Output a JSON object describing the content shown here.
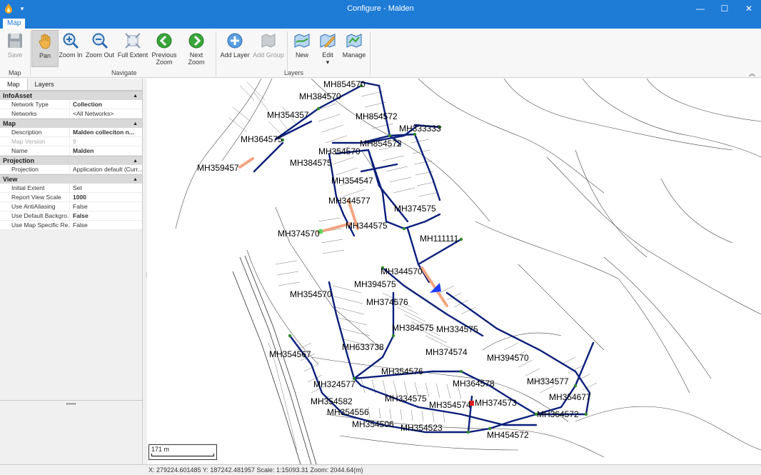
{
  "window": {
    "title": "Configure - Malden",
    "minimize": "—",
    "maximize": "☐",
    "close": "✕",
    "quick_access": "▾"
  },
  "ribbon": {
    "tab": "Map",
    "buttons": {
      "save": "Save",
      "pan": "Pan",
      "zoom_in": "Zoom In",
      "zoom_out": "Zoom Out",
      "full_extent": "Full Extent",
      "previous_zoom": "Previous Zoom",
      "next_zoom": "Next Zoom",
      "add_layer": "Add Layer",
      "add_group": "Add Group",
      "new": "New",
      "edit": "Edit",
      "manage": "Manage"
    },
    "groups": {
      "map": "Map",
      "navigate": "Navigate",
      "layers": "Layers"
    },
    "edit_caret": "▾",
    "collapse": "︽"
  },
  "panel": {
    "tabs": [
      "Map",
      "Layers"
    ],
    "grip": "•••••",
    "splitter_grip": "⋮",
    "categories": [
      {
        "name": "InfoAsset",
        "caret": "▲",
        "rows": [
          {
            "key": "Network Type",
            "value": "Collection",
            "bold": true,
            "dim": false
          },
          {
            "key": "Networks",
            "value": "<All Networks>",
            "bold": false,
            "dim": false
          }
        ]
      },
      {
        "name": "Map",
        "caret": "▲",
        "rows": [
          {
            "key": "Description",
            "value": "Malden colleciton n...",
            "bold": true,
            "dim": false
          },
          {
            "key": "Map Version",
            "value": "9",
            "bold": false,
            "dim": true
          },
          {
            "key": "Name",
            "value": "Malden",
            "bold": true,
            "dim": false
          }
        ]
      },
      {
        "name": "Projection",
        "caret": "▲",
        "rows": [
          {
            "key": "Projection",
            "value": "Application default (Curr...",
            "bold": false,
            "dim": false
          }
        ]
      },
      {
        "name": "View",
        "caret": "▲",
        "rows": [
          {
            "key": "Initial Extent",
            "value": "Set",
            "bold": false,
            "dim": false
          },
          {
            "key": "Report View Scale",
            "value": "1000",
            "bold": true,
            "dim": false
          },
          {
            "key": "Use AntiAliasing",
            "value": "False",
            "bold": false,
            "dim": false
          },
          {
            "key": "Use Default Backgro...",
            "value": "False",
            "bold": true,
            "dim": false
          },
          {
            "key": "Use Map Specific Re...",
            "value": "False",
            "bold": false,
            "dim": false
          }
        ]
      }
    ]
  },
  "map": {
    "scale_label": "171 m",
    "node_labels": [
      "MH854570",
      "MH384570",
      "MH354357",
      "MH854572",
      "MH333333",
      "MH364575",
      "MH354570",
      "MH854572",
      "MH359457",
      "MH384575",
      "MH354547",
      "MH344577",
      "MH374575",
      "MH374570",
      "MH344575",
      "MH111111",
      "MH344570",
      "MH394575",
      "MH354570",
      "MH374576",
      "MH384575",
      "MH334575",
      "MH354567",
      "MH633738",
      "MH374574",
      "MH394570",
      "MH354576",
      "MH324577",
      "MH364578",
      "MH334577",
      "MH334575",
      "MH354582",
      "MH354574",
      "MH374573",
      "MH354677",
      "MH354556",
      "MH364572",
      "MH354506",
      "MH354523",
      "MH454572"
    ]
  },
  "status": {
    "text": "X: 279224.601485 Y: 187242.481957 Scale: 1:15093.31 Zoom: 2044.64(m)"
  }
}
